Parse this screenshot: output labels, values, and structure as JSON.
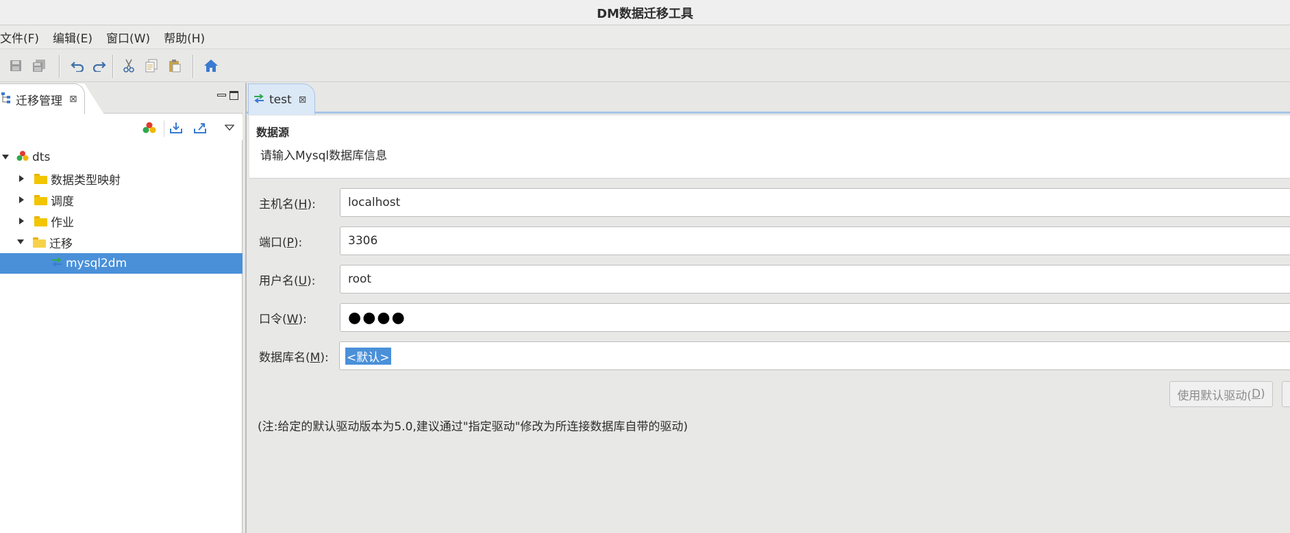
{
  "window": {
    "title": "DM数据迁移工具"
  },
  "menu": [
    "文件(F)",
    "编辑(E)",
    "窗口(W)",
    "帮助(H)"
  ],
  "toolbar_icons": [
    "save-icon",
    "save-all-icon",
    "undo-icon",
    "redo-icon",
    "cut-icon",
    "copy-icon",
    "paste-icon",
    "home-icon"
  ],
  "left_panel": {
    "tab_label": "迁移管理",
    "tree": {
      "root": "dts",
      "children": [
        {
          "label": "数据类型映射",
          "expanded": false
        },
        {
          "label": "调度",
          "expanded": false
        },
        {
          "label": "作业",
          "expanded": false
        },
        {
          "label": "迁移",
          "expanded": true
        }
      ],
      "selected_leaf": "mysql2dm"
    }
  },
  "editor": {
    "tab_label": "test",
    "header_title": "数据源",
    "header_subtitle": "请输入Mysql数据库信息",
    "fields": {
      "host": {
        "label_pre": "主机名(",
        "key": "H",
        "label_post": "):",
        "value": "localhost"
      },
      "port": {
        "label_pre": "端口(",
        "key": "P",
        "label_post": "):",
        "value": "3306"
      },
      "user": {
        "label_pre": "用户名(",
        "key": "U",
        "label_post": "):",
        "value": "root"
      },
      "password": {
        "label_pre": "口令(",
        "key": "W",
        "label_post": "):",
        "value": "●●●●"
      },
      "database": {
        "label_pre": "数据库名(",
        "key": "M",
        "label_post": "):",
        "value": "<默认>"
      }
    },
    "driver_button": {
      "label_pre": "使用默认驱动(",
      "key": "D",
      "label_post": ")"
    },
    "note": "(注:给定的默认驱动版本为5.0,建议通过\"指定驱动\"修改为所连接数据库自带的驱动)"
  }
}
